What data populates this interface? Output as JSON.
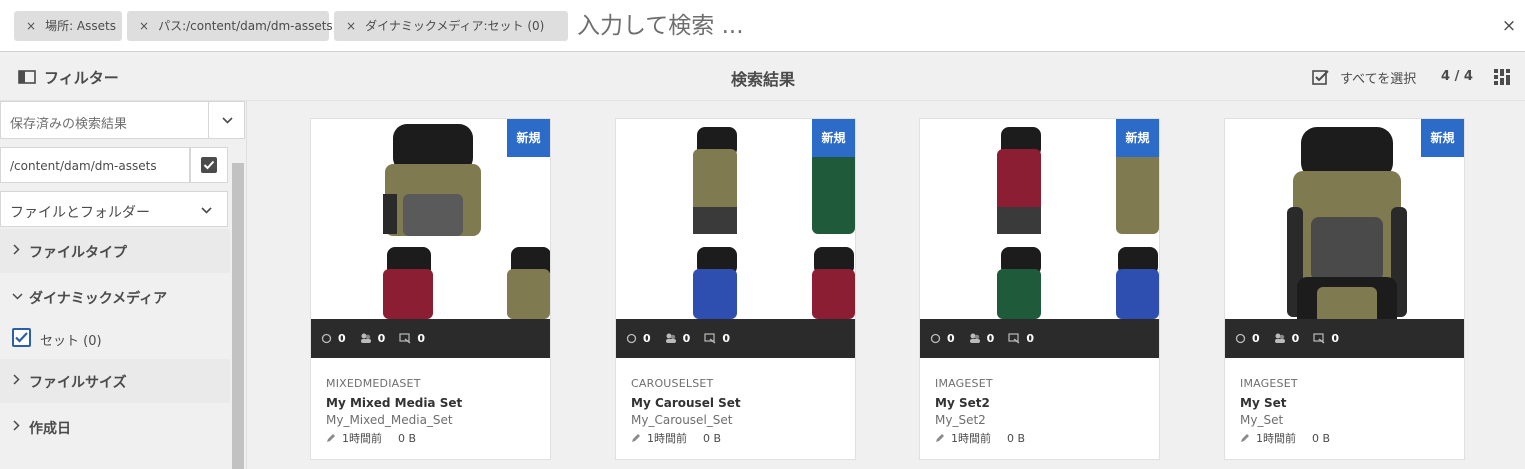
{
  "search": {
    "tags": [
      {
        "label": "場所: Assets"
      },
      {
        "label": "パス:/content/dam/dm-assets"
      },
      {
        "label": "ダイナミックメディア:セット (0)"
      }
    ],
    "placeholder": "入力して検索 ...",
    "close_icon": "×",
    "tag_close_icon": "×"
  },
  "toolbar": {
    "filter_label": "フィルター",
    "results_title": "検索結果",
    "select_all_label": "すべてを選択",
    "count": "4 / 4"
  },
  "sidebar": {
    "saved_search": "保存済みの検索結果",
    "path": "/content/dam/dm-assets",
    "file_folder": "ファイルとフォルダー",
    "sections": {
      "file_type": "ファイルタイプ",
      "dynamic_media": "ダイナミックメディア",
      "file_size": "ファイルサイズ",
      "created": "作成日"
    },
    "set_checkbox_label": "セット (0)",
    "set_checked": true
  },
  "cards": [
    {
      "badge": "新規",
      "type": "MIXEDMEDIASET",
      "title": "My Mixed Media Set",
      "name": "My_Mixed_Media_Set",
      "time": "1時間前",
      "size": "0 B",
      "stats": [
        "0",
        "0",
        "0"
      ],
      "layout": "mixed"
    },
    {
      "badge": "新規",
      "type": "CAROUSELSET",
      "title": "My Carousel Set",
      "name": "My_Carousel_Set",
      "time": "1時間前",
      "size": "0 B",
      "stats": [
        "0",
        "0",
        "0"
      ],
      "layout": "carousel"
    },
    {
      "badge": "新規",
      "type": "IMAGESET",
      "title": "My Set2",
      "name": "My_Set2",
      "time": "1時間前",
      "size": "0 B",
      "stats": [
        "0",
        "0",
        "0"
      ],
      "layout": "set2"
    },
    {
      "badge": "新規",
      "type": "IMAGESET",
      "title": "My Set",
      "name": "My_Set",
      "time": "1時間前",
      "size": "0 B",
      "stats": [
        "0",
        "0",
        "0"
      ],
      "layout": "single"
    }
  ],
  "colors": {
    "accent": "#2d6bc8",
    "badge_text": "#ffffff",
    "stats_bg": "#2b2b2b",
    "pack_olive": "#7f7a50",
    "pack_red": "#8c1e34",
    "pack_green": "#1f5a3a",
    "pack_blue": "#2f4fb0",
    "pack_black": "#1c1c1c"
  }
}
